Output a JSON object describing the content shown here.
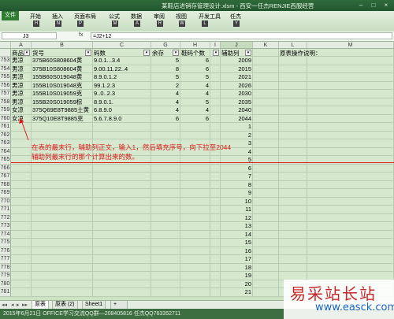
{
  "titlebar": {
    "title": "某鞋店进销存管理设计.xlsm - 西安一任杰RENJIE西服经营",
    "min": "–",
    "max": "□",
    "close": "×"
  },
  "ribbon": {
    "file_label": "文件",
    "tabs": [
      {
        "label": "开始",
        "key": "H"
      },
      {
        "label": "插入",
        "key": "N"
      },
      {
        "label": "页面布局",
        "key": "P"
      },
      {
        "label": "公式",
        "key": "M"
      },
      {
        "label": "数据",
        "key": "A"
      },
      {
        "label": "审阅",
        "key": "R"
      },
      {
        "label": "视图",
        "key": "W"
      },
      {
        "label": "开发工具",
        "key": "L"
      },
      {
        "label": "任杰",
        "key": "Y"
      }
    ]
  },
  "formula": {
    "namebox": "J3",
    "fx": "fx",
    "value": "=J2+12"
  },
  "columns": [
    "A",
    "B",
    "C",
    "G",
    "H",
    "I",
    "J",
    "K",
    "L",
    "M"
  ],
  "headers": {
    "a": "商品",
    "b": "货号",
    "c": "码数",
    "g": "余存",
    "h": "鞋码个数",
    "i": "",
    "j": "辅助列",
    "l": "原表操作说明："
  },
  "rows": [
    {
      "num": "753",
      "a": "男凉",
      "b": "375B60S808604黄",
      "c": "9.0.1...3.4",
      "g": "5",
      "h": "6",
      "j": "2009"
    },
    {
      "num": "754",
      "a": "男凉",
      "b": "375B10S808604黄",
      "c": "9.00.11.22..4",
      "g": "8",
      "h": "6",
      "j": "2015"
    },
    {
      "num": "755",
      "a": "男凉",
      "b": "155B60S019048黄",
      "c": "8.9.0.1.2",
      "g": "5",
      "h": "5",
      "j": "2021"
    },
    {
      "num": "756",
      "a": "男凉",
      "b": "155B10S019048克",
      "c": "99.1.2.3",
      "g": "2",
      "h": "4",
      "j": "2026"
    },
    {
      "num": "757",
      "a": "男凉",
      "b": "155B10S019059克",
      "c": "9..0..2.3",
      "g": "4",
      "h": "4",
      "j": "2030"
    },
    {
      "num": "758",
      "a": "男凉",
      "b": "155B20S019059棕",
      "c": "8.9.0.1.",
      "g": "4",
      "h": "5",
      "j": "2035"
    },
    {
      "num": "759",
      "a": "女凉",
      "b": "375Q69E8T9885土黄",
      "c": "6.8.9.0",
      "g": "4",
      "h": "4",
      "j": "2040"
    },
    {
      "num": "760",
      "a": "女凉",
      "b": "375Q10E8T9885克",
      "c": "5.6.7.8.9.0",
      "g": "6",
      "h": "6",
      "j": "2044"
    },
    {
      "num": "761",
      "j": "1"
    },
    {
      "num": "762",
      "j": "2"
    },
    {
      "num": "763",
      "j": "3"
    },
    {
      "num": "764",
      "j": "4"
    },
    {
      "num": "765",
      "j": "5"
    },
    {
      "num": "766",
      "j": "6"
    },
    {
      "num": "767",
      "j": "7"
    },
    {
      "num": "768",
      "j": "8"
    },
    {
      "num": "769",
      "j": "9"
    },
    {
      "num": "770",
      "j": "10"
    },
    {
      "num": "771",
      "j": "11"
    },
    {
      "num": "772",
      "j": "12"
    },
    {
      "num": "773",
      "j": "13"
    },
    {
      "num": "774",
      "j": "14"
    },
    {
      "num": "775",
      "j": "15"
    },
    {
      "num": "776",
      "j": "16"
    },
    {
      "num": "777",
      "j": "17"
    },
    {
      "num": "778",
      "j": "18"
    },
    {
      "num": "779",
      "j": "19"
    },
    {
      "num": "780",
      "j": "20"
    },
    {
      "num": "781",
      "j": "21"
    }
  ],
  "annotation": "在表的最末行，辅助列正文，输入1，然后填充序号，向下拉至2044辅助列最末行的那个计算出来的数。",
  "sheets": [
    "原表",
    "原表 (2)",
    "Sheet1"
  ],
  "status": {
    "text": "2015年6月21日    OFFICE学习交流QQ群—208405816    任杰QQ763352711"
  },
  "watermark": {
    "cn": "易采站长站",
    "url": "www.easck.com"
  },
  "colors": {
    "annotation": "#e01818",
    "statusbar": "#3c6e42",
    "grid": "#d6e9cf"
  }
}
